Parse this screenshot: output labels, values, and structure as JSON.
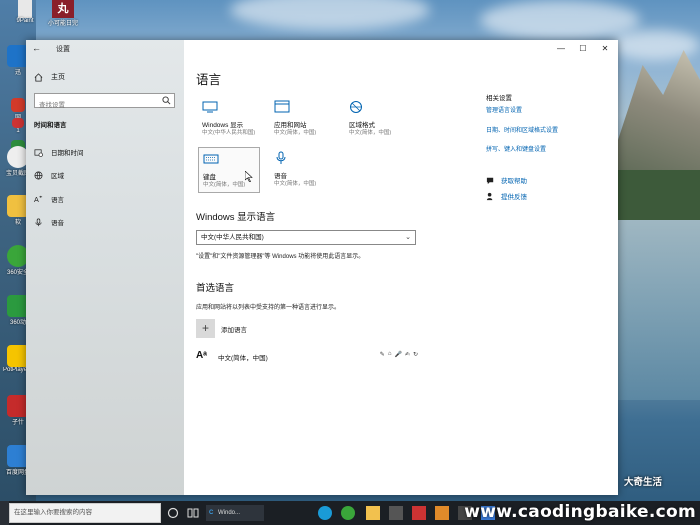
{
  "desktop": {
    "top_icons": [
      {
        "label": "9Paint"
      },
      {
        "label": "小可能日完"
      }
    ],
    "side_icons": [
      {
        "label": "迅"
      },
      {
        "label": "网"
      },
      {
        "label": "1"
      },
      {
        "label": "5"
      },
      {
        "label": "宝贝截图"
      },
      {
        "label": "软"
      },
      {
        "label": "360安全"
      },
      {
        "label": "360动"
      },
      {
        "label": "PotPlayer 64 bit"
      },
      {
        "label": "子什"
      },
      {
        "label": "百度网盘"
      }
    ],
    "brand_text": "大奇生活",
    "watermark": "www.caodingbaike.com"
  },
  "window": {
    "title": "设置",
    "back_glyph": "←",
    "controls": {
      "minimize": "—",
      "maximize": "☐",
      "close": "✕"
    }
  },
  "sidebar": {
    "home_label": "主页",
    "search_placeholder": "查找设置",
    "section_label": "时间和语言",
    "items": [
      {
        "label": "日期和时间",
        "icon": "calendar-clock-icon"
      },
      {
        "label": "区域",
        "icon": "globe-icon"
      },
      {
        "label": "语言",
        "icon": "language-icon"
      },
      {
        "label": "语音",
        "icon": "microphone-icon"
      }
    ]
  },
  "main": {
    "title": "语言",
    "tiles": [
      {
        "title": "Windows 显示",
        "subtitle": "中文(中华人民共和国)",
        "icon": "monitor-icon"
      },
      {
        "title": "应用和网站",
        "subtitle": "中文(简体，中国)",
        "icon": "window-icon"
      },
      {
        "title": "区域格式",
        "subtitle": "中文(简体，中国)",
        "icon": "globe-icon"
      },
      {
        "title": "键盘",
        "subtitle": "中文(简体，中国)",
        "icon": "keyboard-icon"
      },
      {
        "title": "语音",
        "subtitle": "中文(简体，中国)",
        "icon": "microphone-icon"
      }
    ],
    "display_language_heading": "Windows 显示语言",
    "display_language_value": "中文(中华人民共和国)",
    "display_language_note": "\"设置\"和\"文件资源管理器\"等 Windows 功能将使用此语言显示。",
    "preferred_heading": "首选语言",
    "preferred_note": "应用和网站将以列表中受支持的第一种语言进行显示。",
    "add_language_label": "添加语言",
    "language_entry": {
      "name": "中文(简体，中国)",
      "features": [
        "✎",
        "⌂",
        "🎤",
        "✍",
        "↻"
      ]
    }
  },
  "related": {
    "heading": "相关设置",
    "links": [
      "管理语言设置",
      "日期、时间和区域格式设置",
      "拼写、键入和键盘设置"
    ],
    "help": [
      {
        "label": "获取帮助",
        "icon": "chat-help-icon"
      },
      {
        "label": "提供反馈",
        "icon": "feedback-icon"
      }
    ]
  },
  "taskbar": {
    "search_placeholder": "在这里输入你要搜索的内容",
    "app_labels": [
      "C",
      "Windo..."
    ]
  },
  "colors": {
    "accent": "#0063b1",
    "taskbar": "#1b1f24"
  }
}
